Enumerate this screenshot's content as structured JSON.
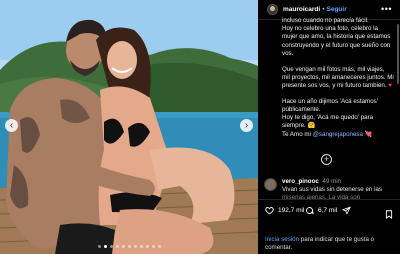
{
  "post": {
    "username": "mauroicardi",
    "separator": "•",
    "follow_label": "Seguir",
    "more_label": "•••",
    "caption": {
      "line1": "incluso cuando no parecía fácil.",
      "para1": "Hoy no celebro una foto, celebro la mujer que amo, la historia que estamos construyendo y el futuro que sueño con vos.",
      "para2a": "Que vengan mil fotos más, mil viajes, mil proyectos, mil amaneceres juntos. Mi presente sos vos, y mi futuro también.",
      "para2_emoji": "♥",
      "para3a": "Hace un año dijimos 'Acá estamos' públicamente.",
      "para3b": "Hoy te digo, 'Acá me quedo' para siempre.",
      "para3_emoji": "🤗",
      "para3c": "Te Amo mi",
      "mention": "@sangrejaponesa",
      "para3_end_emoji": "💘"
    },
    "add_comment_icon": "plus-circle-icon",
    "comment": {
      "user": "vero_pinooc",
      "time": "49 min",
      "body": "Vivan sus vidas sin detenerse en las",
      "body_fade": "miserias ajenas. La vida son"
    },
    "actions": {
      "likes": "192,7 mil",
      "comments": "6,7 mil",
      "share_icon": "send-icon",
      "save_icon": "bookmark-icon"
    },
    "login": {
      "link": "Inicia sesión",
      "rest": "para indicar que te gusta o comentar."
    }
  },
  "carousel": {
    "prev_label": "‹",
    "next_label": "›",
    "slides": 11,
    "active_slide": 1
  },
  "colors": {
    "accent": "#5aa7ff",
    "background": "#000000",
    "heart": "#ff3a5c"
  }
}
